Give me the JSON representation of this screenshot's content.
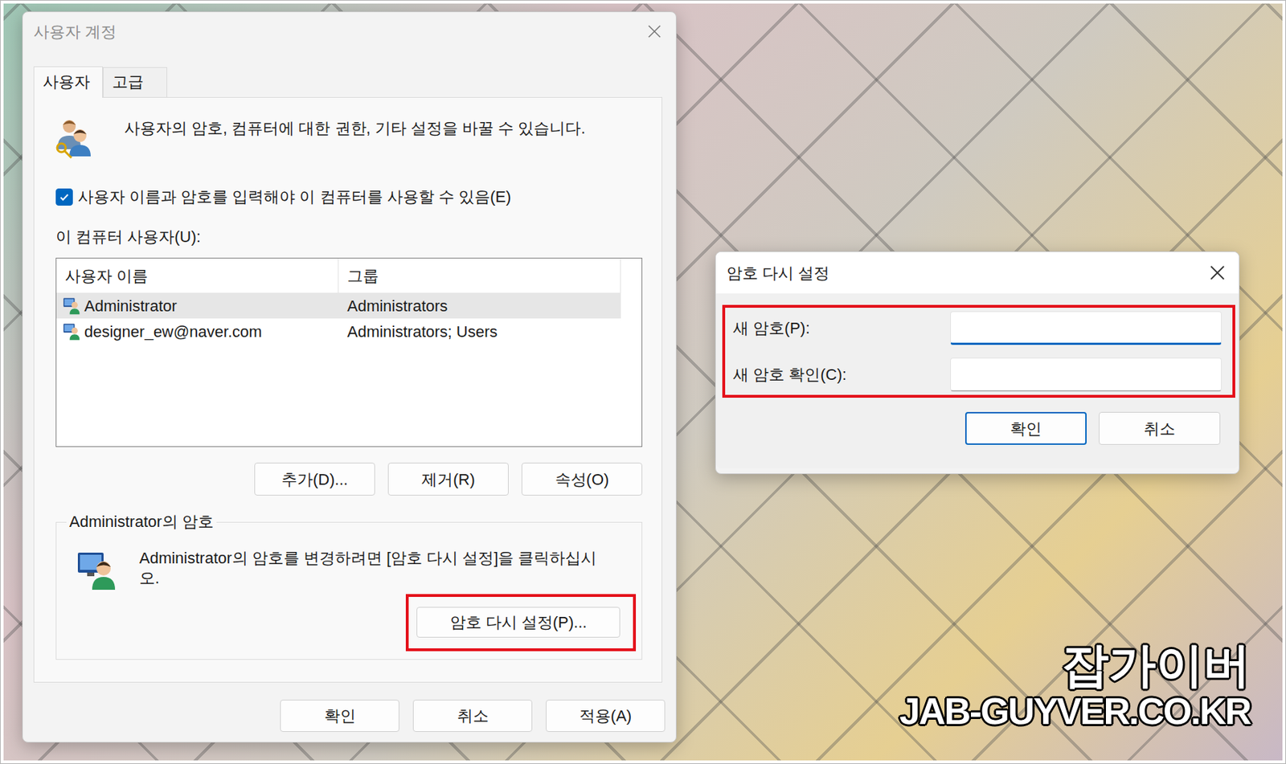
{
  "user_accounts": {
    "title": "사용자 계정",
    "tabs": [
      {
        "label": "사용자",
        "selected": true
      },
      {
        "label": "고급",
        "selected": false
      }
    ],
    "description": "사용자의 암호, 컴퓨터에 대한 권한, 기타 설정을 바꿀 수 있습니다.",
    "require_login": {
      "label": "사용자 이름과 암호를 입력해야 이 컴퓨터를 사용할 수 있음(E)",
      "checked": true
    },
    "users_label": "이 컴퓨터 사용자(U):",
    "table": {
      "columns": [
        "사용자 이름",
        "그룹"
      ],
      "rows": [
        {
          "cells": [
            "Administrator",
            "Administrators"
          ],
          "selected": true
        },
        {
          "cells": [
            "designer_ew@naver.com",
            "Administrators; Users"
          ],
          "selected": false
        }
      ]
    },
    "list_buttons": [
      "추가(D)...",
      "제거(R)",
      "속성(O)"
    ],
    "password_group": {
      "title": "Administrator의 암호",
      "text": "Administrator의 암호를 변경하려면 [암호 다시 설정]을 클릭하십시오.",
      "button": {
        "label": "암호 다시 설정(P)...",
        "highlighted": true
      }
    },
    "buttons": [
      "확인",
      "취소",
      "적용(A)"
    ]
  },
  "reset_dialog": {
    "title": "암호 다시 설정",
    "fields": [
      {
        "label": "새 암호(P):",
        "value": "",
        "focused": true
      },
      {
        "label": "새 암호 확인(C):",
        "value": "",
        "focused": false
      }
    ],
    "fields_highlighted": true,
    "buttons": [
      {
        "label": "확인",
        "default": true
      },
      {
        "label": "취소",
        "default": false
      }
    ]
  },
  "watermark": {
    "name": "잡가이버",
    "url": "JAB-GUYVER.CO.KR"
  }
}
